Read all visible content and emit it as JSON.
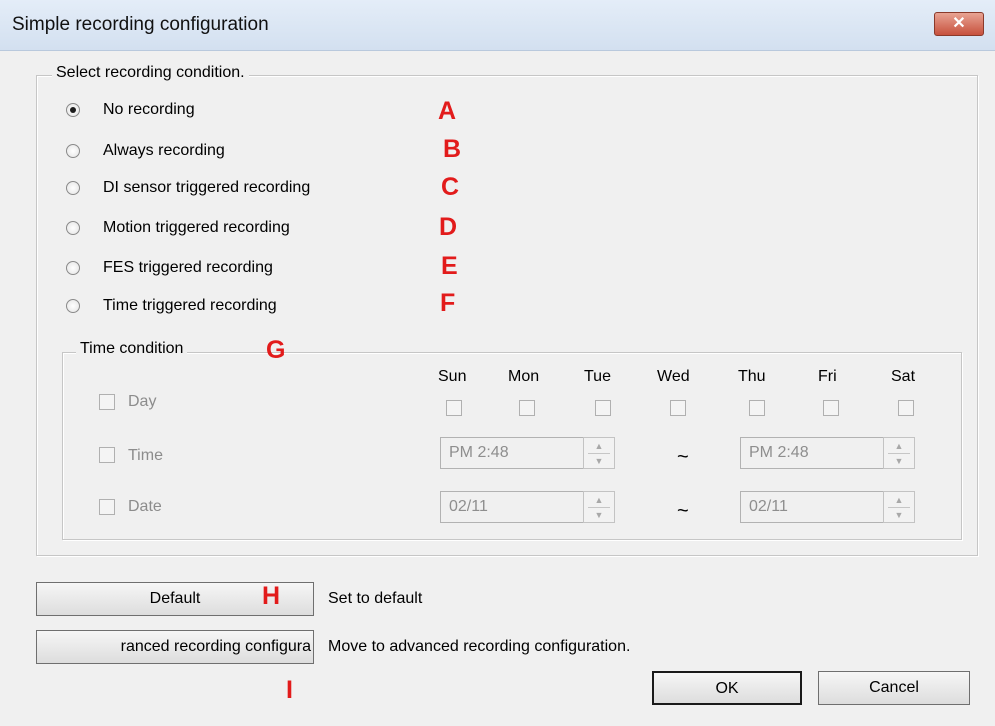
{
  "window": {
    "title": "Simple recording configuration",
    "close_glyph": "✕"
  },
  "recording_condition": {
    "legend": "Select recording condition.",
    "options": [
      {
        "label": "No recording",
        "marker": "A",
        "checked": true
      },
      {
        "label": "Always recording",
        "marker": "B",
        "checked": false
      },
      {
        "label": "DI sensor triggered recording",
        "marker": "C",
        "checked": false
      },
      {
        "label": "Motion triggered recording",
        "marker": "D",
        "checked": false
      },
      {
        "label": "FES triggered recording",
        "marker": "E",
        "checked": false
      },
      {
        "label": "Time triggered recording",
        "marker": "F",
        "checked": false
      }
    ]
  },
  "time_condition": {
    "legend": "Time condition",
    "marker": "G",
    "days": [
      "Sun",
      "Mon",
      "Tue",
      "Wed",
      "Thu",
      "Fri",
      "Sat"
    ],
    "day_label": "Day",
    "time_label": "Time",
    "date_label": "Date",
    "time_start": "PM  2:48",
    "time_end": "PM  2:48",
    "date_start": "02/11",
    "date_end": "02/11",
    "range_separator": "~"
  },
  "buttons": {
    "default_label": "Default",
    "default_marker": "H",
    "default_desc": "Set to default",
    "advanced_label": "ranced recording configura",
    "advanced_marker": "I",
    "advanced_desc": "Move to advanced recording configuration.",
    "ok_label": "OK",
    "cancel_label": "Cancel"
  },
  "colors": {
    "marker": "#e21b1b",
    "disabled_text": "#8c8c8c",
    "background": "#f0f0f0"
  }
}
